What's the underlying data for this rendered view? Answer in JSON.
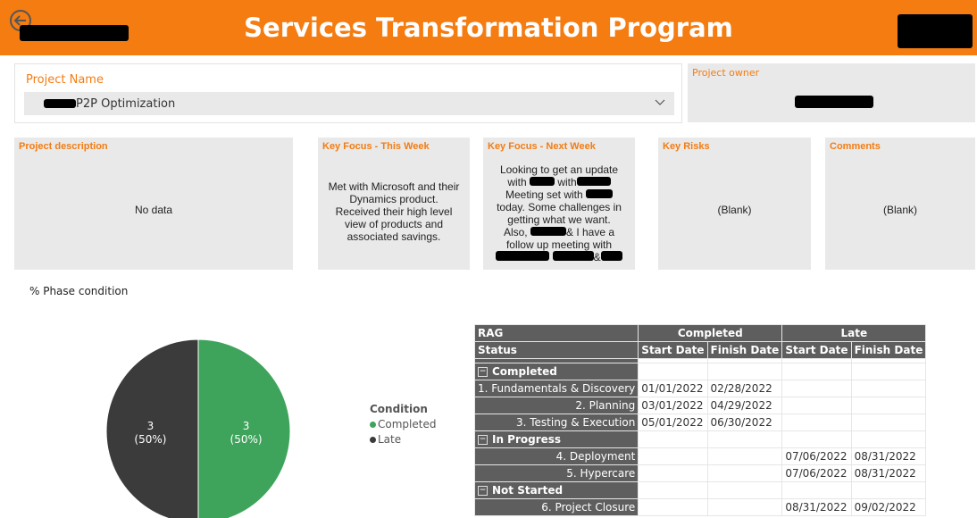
{
  "header": {
    "title": "Services Transformation Program"
  },
  "project_slicer": {
    "label": "Project Name",
    "selected_value": "P2P Optimization"
  },
  "project_owner": {
    "label": "Project owner"
  },
  "cards": {
    "description": {
      "title": "Project description",
      "text": "No data"
    },
    "focus_this_week": {
      "title": "Key Focus - This Week",
      "text": "Met with Microsoft and their Dynamics product. Received their high level view of products and associated savings."
    },
    "focus_next_week": {
      "title": "Key Focus - Next Week",
      "lines": [
        "Looking to get an update",
        "with",
        "with",
        "Meeting set with",
        "today. Some challenges in",
        "getting what we want.",
        "Also,",
        "& I have a",
        "follow up meeting with",
        "&"
      ]
    },
    "key_risks": {
      "title": "Key Risks",
      "text": "(Blank)"
    },
    "comments": {
      "title": "Comments",
      "text": "(Blank)"
    }
  },
  "phase_chart": {
    "title": "% Phase condition"
  },
  "chart_data": {
    "type": "pie",
    "slices": [
      {
        "name": "Completed",
        "value": 3,
        "label": "3",
        "percent": "(50%)",
        "color": "#3fa45b"
      },
      {
        "name": "Late",
        "value": 3,
        "label": "3",
        "percent": "(50%)",
        "color": "#3b3b3b"
      }
    ],
    "legend": {
      "title": "Condition",
      "placement": "right"
    }
  },
  "rag_table": {
    "header_row1": [
      "RAG",
      "Completed",
      "Late"
    ],
    "header_row2": [
      "Status",
      "Start Date",
      "Finish Date",
      "Start Date",
      "Finish Date"
    ],
    "groups": [
      {
        "name": "Completed",
        "rows": [
          {
            "name": "1. Fundamentals & Discovery",
            "c_start": "01/01/2022",
            "c_finish": "02/28/2022",
            "l_start": "",
            "l_finish": ""
          },
          {
            "name": "2. Planning",
            "c_start": "03/01/2022",
            "c_finish": "04/29/2022",
            "l_start": "",
            "l_finish": ""
          },
          {
            "name": "3. Testing & Execution",
            "c_start": "05/01/2022",
            "c_finish": "06/30/2022",
            "l_start": "",
            "l_finish": ""
          }
        ]
      },
      {
        "name": "In Progress",
        "rows": [
          {
            "name": "4. Deployment",
            "c_start": "",
            "c_finish": "",
            "l_start": "07/06/2022",
            "l_finish": "08/31/2022"
          },
          {
            "name": "5. Hypercare",
            "c_start": "",
            "c_finish": "",
            "l_start": "07/06/2022",
            "l_finish": "08/31/2022"
          }
        ]
      },
      {
        "name": "Not Started",
        "rows": [
          {
            "name": "6. Project Closure",
            "c_start": "",
            "c_finish": "",
            "l_start": "08/31/2022",
            "l_finish": "09/02/2022"
          }
        ]
      }
    ]
  }
}
